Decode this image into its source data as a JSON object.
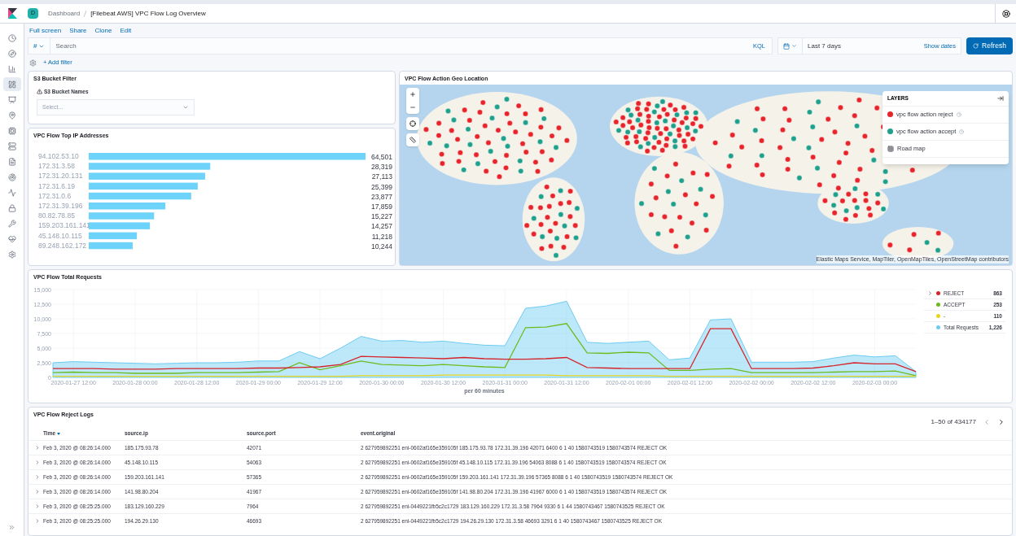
{
  "header": {
    "space_initial": "D",
    "breadcrumbs": [
      "Dashboard",
      "[Filebeat AWS] VPC Flow Log Overview"
    ]
  },
  "sidebar": {
    "items": [
      {
        "kind": "recent",
        "selected": false
      },
      {
        "kind": "discover",
        "selected": false
      },
      {
        "kind": "visualize",
        "selected": false
      },
      {
        "kind": "dashboard",
        "selected": true
      },
      {
        "kind": "canvas",
        "selected": false
      },
      {
        "kind": "maps",
        "selected": false
      },
      {
        "kind": "ml",
        "selected": false
      },
      {
        "kind": "infra",
        "selected": false
      },
      {
        "kind": "logs",
        "selected": false
      },
      {
        "kind": "apm",
        "selected": false
      },
      {
        "kind": "uptime",
        "selected": false
      },
      {
        "kind": "siem",
        "selected": false
      },
      {
        "kind": "devtools",
        "selected": false
      },
      {
        "kind": "monitoring",
        "selected": false
      },
      {
        "kind": "management",
        "selected": false
      }
    ]
  },
  "top_links": [
    "Full screen",
    "Share",
    "Clone",
    "Edit"
  ],
  "query": {
    "language_toggle": "#",
    "placeholder": "Search",
    "language": "KQL",
    "time_range": "Last 7 days",
    "show_dates": "Show dates",
    "refresh": "Refresh"
  },
  "filter": {
    "add": "+ Add filter"
  },
  "s3_filter": {
    "title": "S3 Bucket Filter",
    "control_label": "S3 Bucket Names",
    "placeholder": "Select..."
  },
  "top_ips": {
    "chart_data": {
      "type": "bar",
      "orientation": "horizontal",
      "title": "VPC Flow Top IP Addresses",
      "value_labels": [
        "64,501",
        "28,319",
        "27,113",
        "25,399",
        "23,877",
        "17,859",
        "15,227",
        "14,257",
        "11,218",
        "10,244"
      ],
      "categories": [
        "94.102.53.10",
        "172.31.3.58",
        "172.31.20.131",
        "172.31.6.19",
        "172.31.0.6",
        "172.31.39.196",
        "80.82.78.85",
        "159.203.161.141",
        "45.148.10.115",
        "89.248.162.172"
      ],
      "values": [
        64501,
        28319,
        27113,
        25399,
        23877,
        17859,
        15227,
        14257,
        11218,
        10244
      ]
    }
  },
  "map": {
    "title": "VPC Flow Action Geo Location",
    "layers_title": "LAYERS",
    "layers": [
      {
        "kind": "points",
        "label": "vpc flow action reject",
        "color": "#e7242a"
      },
      {
        "kind": "points",
        "label": "vpc flow action accept",
        "color": "#1fa08c"
      },
      {
        "kind": "tiles",
        "label": "Road map"
      }
    ],
    "attribution": "Elastic Maps Service, MapTiler, OpenMapTiles, OpenStreetMap contributors"
  },
  "requests": {
    "legend_counts": [
      "863",
      "253",
      "110",
      "1,226"
    ],
    "chart_data": {
      "type": "line",
      "title": "VPC Flow Total Requests",
      "xlabel": "per 60 minutes",
      "grid": true,
      "ylim": [
        0,
        15000
      ],
      "categories": [
        null,
        "2020-01-27 12:00",
        null,
        null,
        "2020-01-28 00:00",
        null,
        null,
        "2020-01-28 12:00",
        null,
        null,
        "2020-01-29 00:00",
        null,
        null,
        "2020-01-29 12:00",
        null,
        null,
        "2020-01-30 00:00",
        null,
        null,
        "2020-01-30 12:00",
        null,
        null,
        "2020-01-31 00:00",
        null,
        null,
        "2020-01-31 12:00",
        null,
        null,
        "2020-02-01 00:00",
        null,
        null,
        "2020-02-01 12:00",
        null,
        null,
        "2020-02-02 00:00",
        null,
        null,
        "2020-02-02 12:00",
        null,
        null,
        "2020-02-03 00:00",
        null,
        null
      ],
      "yticks": [
        {
          "value": 0,
          "label": "0"
        },
        {
          "value": 2500,
          "label": "2,500"
        },
        {
          "value": 5000,
          "label": "5,000"
        },
        {
          "value": 7500,
          "label": "7,500"
        },
        {
          "value": 10000,
          "label": "10,000"
        },
        {
          "value": 12500,
          "label": "12,500"
        },
        {
          "value": 15000,
          "label": "15,000"
        }
      ],
      "series": [
        {
          "name": "REJECT",
          "color": "#d6242a",
          "values": [
            1500,
            1500,
            1500,
            1400,
            1400,
            1400,
            1500,
            1500,
            1500,
            1500,
            1600,
            1600,
            1700,
            1800,
            2200,
            3600,
            3500,
            3400,
            3300,
            3200,
            3400,
            3200,
            3100,
            3100,
            3200,
            3400,
            1700,
            1600,
            1500,
            1500,
            1500,
            1500,
            8300,
            8300,
            1500,
            1500,
            1500,
            1600,
            2000,
            2500,
            2300,
            2300,
            1000
          ]
        },
        {
          "name": "ACCEPT",
          "color": "#6dbb1f",
          "values": [
            800,
            900,
            800,
            800,
            700,
            700,
            700,
            800,
            800,
            800,
            900,
            1000,
            2500,
            1300,
            2000,
            2800,
            2200,
            2100,
            2000,
            2200,
            2000,
            1800,
            1700,
            8500,
            8600,
            9200,
            4200,
            4100,
            4300,
            4200,
            1200,
            1200,
            1400,
            1500,
            800,
            800,
            800,
            800,
            900,
            1000,
            1000,
            1100,
            300
          ]
        },
        {
          "name": "-",
          "color": "#e7d51f",
          "values": [
            200,
            200,
            200,
            200,
            200,
            200,
            200,
            200,
            200,
            200,
            200,
            200,
            200,
            200,
            200,
            300,
            300,
            300,
            300,
            400,
            400,
            400,
            400,
            400,
            400,
            300,
            300,
            300,
            300,
            300,
            200,
            200,
            200,
            200,
            200,
            200,
            200,
            200,
            200,
            200,
            200,
            200,
            200
          ]
        },
        {
          "name": "Total Requests",
          "type": "area",
          "color": "#6dccf1",
          "values": [
            2500,
            2700,
            2600,
            2500,
            2400,
            2300,
            2400,
            2500,
            2500,
            2600,
            2800,
            2800,
            4400,
            3200,
            5000,
            7000,
            6200,
            6300,
            6000,
            6200,
            5800,
            5500,
            5400,
            11800,
            12200,
            13000,
            6000,
            5800,
            6000,
            6200,
            3000,
            3300,
            9800,
            10000,
            2600,
            2600,
            2600,
            2700,
            3300,
            3800,
            3500,
            3700,
            1000
          ]
        }
      ]
    }
  },
  "reject_logs": {
    "title": "VPC Flow Reject Logs",
    "pagination": "1–50 of 434177",
    "columns": [
      {
        "label": "Time",
        "sorted": true
      },
      {
        "label": "source.ip",
        "sorted": false
      },
      {
        "label": "source.port",
        "sorted": false
      },
      {
        "label": "event.original",
        "sorted": false
      }
    ],
    "rows": [
      [
        "Feb 3, 2020 @ 08:26:14.000",
        "185.175.93.78",
        "42071",
        "2 627959892251 eni-0602af165e359105f 185.175.93.78 172.31.39.196 42071 6400 6 1 40 1580743519 1580743574 REJECT OK"
      ],
      [
        "Feb 3, 2020 @ 08:26:14.000",
        "45.148.10.115",
        "54063",
        "2 627959892251 eni-0602af165e359105f 45.148.10.115 172.31.39.196 54063 8088 6 1 40 1580743519 1580743574 REJECT OK"
      ],
      [
        "Feb 3, 2020 @ 08:26:14.000",
        "159.203.161.141",
        "57365",
        "2 627959892251 eni-0602af165e359105f 159.203.161.141 172.31.39.196 57365 8088 6 1 40 1580743519 1580743574 REJECT OK"
      ],
      [
        "Feb 3, 2020 @ 08:26:14.000",
        "141.98.80.204",
        "41967",
        "2 627959892251 eni-0602af165e359105f 141.98.80.204 172.31.39.196 41967 6000 6 1 40 1580743519 1580743574 REJECT OK"
      ],
      [
        "Feb 3, 2020 @ 08:25:25.000",
        "183.129.160.229",
        "7964",
        "2 627959892251 eni-0449221fb5c2c1729 183.129.160.229 172.31.3.58 7964 9330 6 1 44 1580743467 1580743525 REJECT OK"
      ],
      [
        "Feb 3, 2020 @ 08:25:25.000",
        "194.26.29.130",
        "46693",
        "2 627959892251 eni-0449221fb5c2c1729 194.26.29.130 172.31.3.58 46693 3291 6 1 40 1580743467 1580743525 REJECT OK"
      ]
    ]
  }
}
